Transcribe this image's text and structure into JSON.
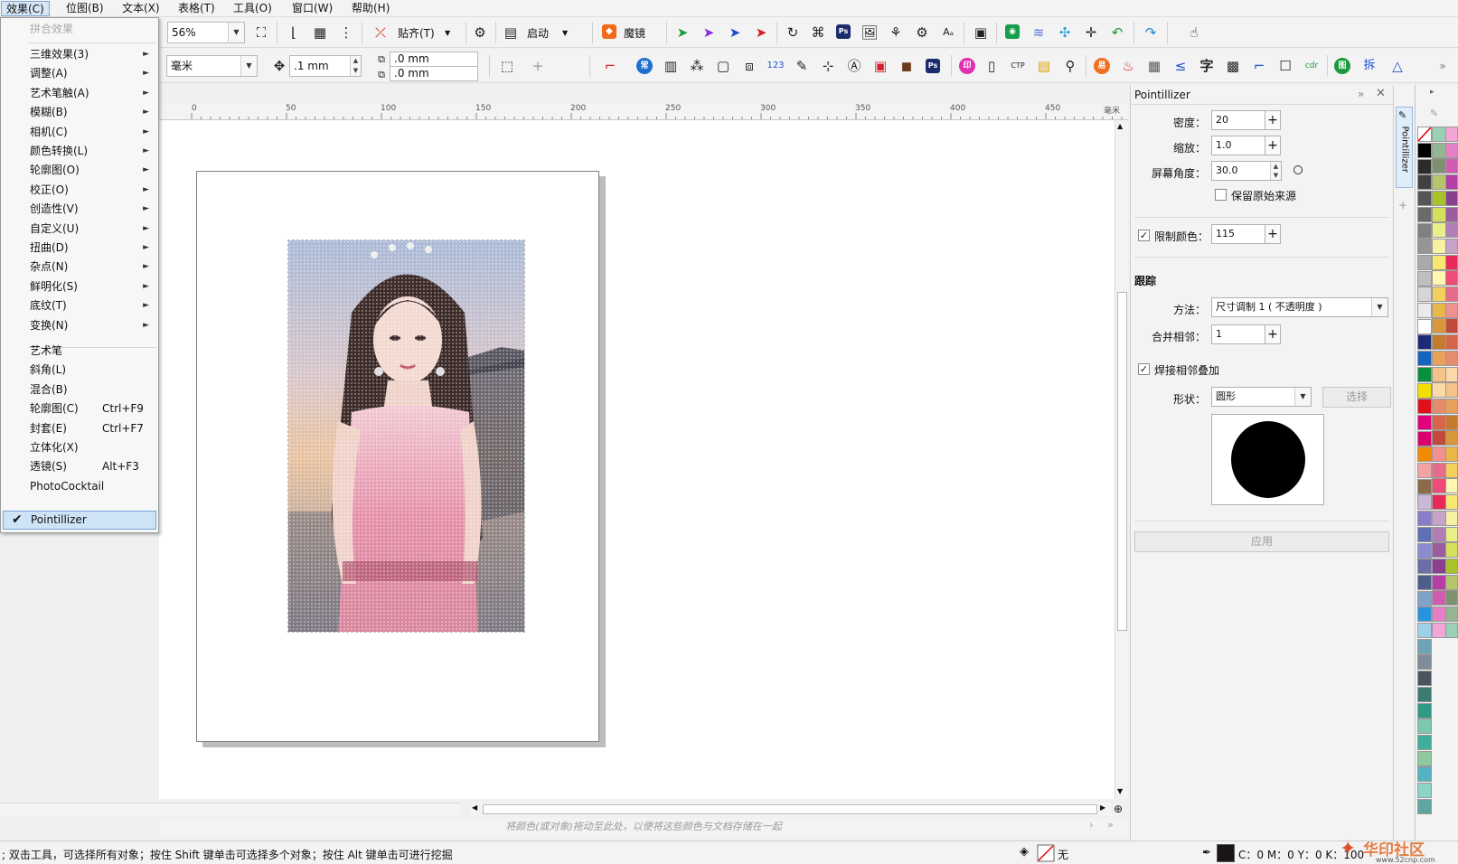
{
  "menubar": {
    "items": [
      "效果(C)",
      "位图(B)",
      "文本(X)",
      "表格(T)",
      "工具(O)",
      "窗口(W)",
      "帮助(H)"
    ]
  },
  "effects_menu": {
    "top_item": "拼合效果",
    "submenus": [
      "三维效果(3)",
      "调整(A)",
      "艺术笔触(A)",
      "模糊(B)",
      "相机(C)",
      "颜色转换(L)",
      "轮廓图(O)",
      "校正(O)",
      "创造性(V)",
      "自定义(U)",
      "扭曲(D)",
      "杂点(N)",
      "鲜明化(S)",
      "底纹(T)",
      "变换(N)"
    ],
    "commands": [
      {
        "label": "艺术笔",
        "shortcut": ""
      },
      {
        "label": "斜角(L)",
        "shortcut": ""
      },
      {
        "label": "混合(B)",
        "shortcut": ""
      },
      {
        "label": "轮廓图(C)",
        "shortcut": "Ctrl+F9"
      },
      {
        "label": "封套(E)",
        "shortcut": "Ctrl+F7"
      },
      {
        "label": "立体化(X)",
        "shortcut": ""
      },
      {
        "label": "透镜(S)",
        "shortcut": "Alt+F3"
      },
      {
        "label": "PhotoCocktail",
        "shortcut": ""
      }
    ],
    "checked_item": "Pointillizer"
  },
  "toolbar1": {
    "zoom": "56%",
    "snap_label": "贴齐(T)",
    "launch_label": "启动",
    "magic_label": "魔镜"
  },
  "toolbar2": {
    "unit": "毫米",
    "nudge": ".1 mm",
    "dup_x": ".0 mm",
    "dup_y": ".0 mm"
  },
  "ruler": {
    "ticks": [
      "0",
      "50",
      "100",
      "150",
      "200",
      "250",
      "300",
      "350",
      "400",
      "450"
    ],
    "unit": "毫米"
  },
  "canvas": {
    "hint": "将颜色(或对象)拖动至此处，以便将这些颜色与文档存储在一起"
  },
  "docker": {
    "title": "Pointillizer",
    "tab_label": "Pointillizer",
    "density_label": "密度：",
    "density": "20",
    "scale_label": "缩放：",
    "scale": "1.0",
    "angle_label": "屏幕角度：",
    "angle": "30.0",
    "keep_source_label": "保留原始来源",
    "limit_colors_label": "限制颜色：",
    "limit_colors": "115",
    "trace_heading": "跟踪",
    "method_label": "方法：",
    "method": "尺寸调制 1 ( 不透明度 )",
    "merge_label": "合并相邻：",
    "merge": "1",
    "weld_label": "焊接相邻叠加",
    "shape_label": "形状：",
    "shape": "圆形",
    "select_button": "选择",
    "apply_button": "应用"
  },
  "status": {
    "message": "; 双击工具，可选择所有对象；按住 Shift 键单击可选择多个对象；按住 Alt 键单击可进行挖掘",
    "fill_label": "无",
    "color_readout": "C：0 M：0 Y：0 K：100"
  },
  "watermark": {
    "site": "华印社区",
    "url": "www.52cnp.com"
  },
  "palette_colors": [
    "#000000",
    "#2b2b2b",
    "#404040",
    "#555555",
    "#6a6a6a",
    "#808080",
    "#959595",
    "#aaaaaa",
    "#bfbfbf",
    "#d5d5d5",
    "#eaeaea",
    "#ffffff",
    "#1e2a78",
    "#1565c0",
    "#0a8f3c",
    "#f3e000",
    "#e0101a",
    "#e3007d",
    "#d9006c",
    "#f08a00",
    "#f3a3a3",
    "#8c6b4a",
    "#c8b9d9",
    "#8a7cc6",
    "#5f6fb5",
    "#8b8bd1",
    "#6d6da8",
    "#4e5d8a",
    "#7fa2c8",
    "#2a93e0",
    "#9fd0ea",
    "#6fa4b8",
    "#7f8c99",
    "#4a5560",
    "#3d7a72",
    "#2f9a86",
    "#7dc7b0",
    "#3fae9a",
    "#90c9a0",
    "#55b2c2",
    "#8ad3c7",
    "#5fa5a0"
  ],
  "palette_colors2": [
    "#9ad0b6",
    "#93b591",
    "#7d9170",
    "#b5c56c",
    "#a6c32b",
    "#d4e05a",
    "#e8f08a",
    "#f6f2a3",
    "#f9e870",
    "#fff6b0",
    "#f2d05b",
    "#e9b64a",
    "#d9963a",
    "#c57b2c",
    "#e8a05a",
    "#f4c38a",
    "#fbd9a8",
    "#e58b6e",
    "#d8644a",
    "#c24a3a",
    "#f09090",
    "#e76b8a",
    "#ef4b78",
    "#e82a5a",
    "#c7a2c8",
    "#b17fb6",
    "#9a5c9f",
    "#8a3f8f",
    "#b53fa4",
    "#d05cb2",
    "#e67fc6",
    "#f3a6d6"
  ]
}
